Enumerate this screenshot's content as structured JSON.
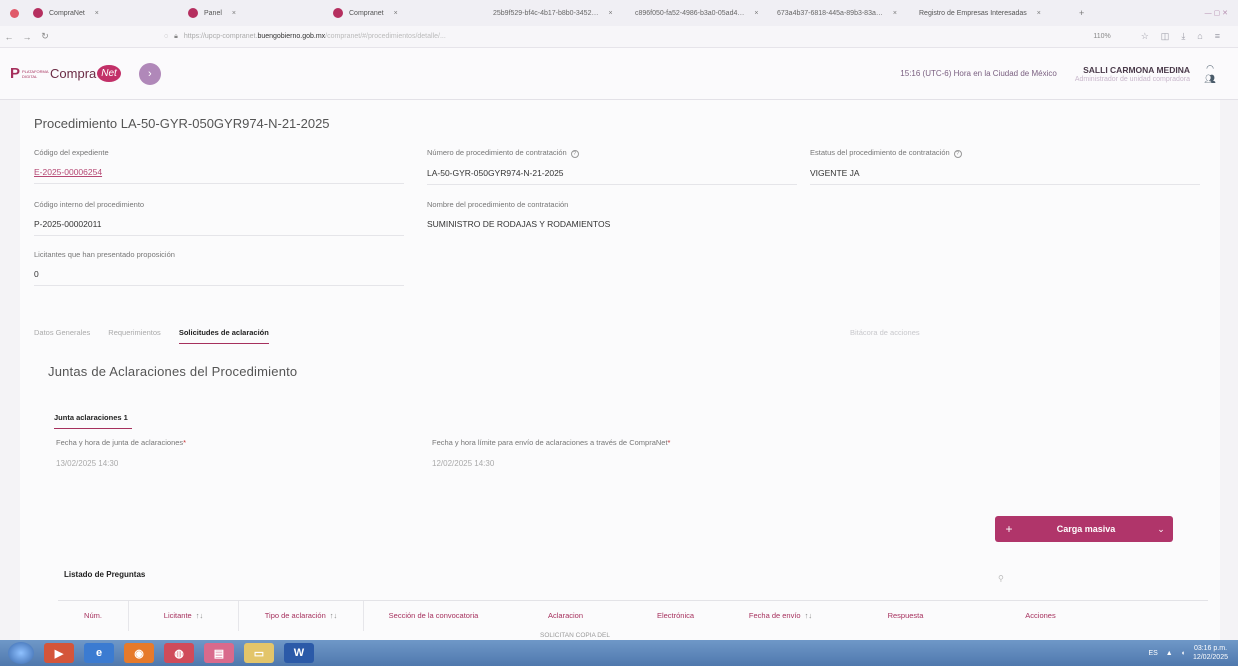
{
  "browser": {
    "tabs": [
      {
        "label": "CompraNet",
        "close": "×"
      },
      {
        "label": "Panel",
        "close": "×"
      },
      {
        "label": "Compranet",
        "close": "×"
      },
      {
        "label": "25b9f529-bf4c-4b17-b8b0-3452…",
        "close": "×"
      },
      {
        "label": "c896f050-fa52-4986-b3a0-05ad4…",
        "close": "×"
      },
      {
        "label": "673a4b37-6818-445a-89b3-83a…",
        "close": "×"
      },
      {
        "label": "Registro de Empresas Interesadas",
        "close": "×"
      }
    ],
    "new_tab": "+",
    "url_prefix": "https://upcp-compranet.",
    "url_host": "buengobierno.gob.mx",
    "url_suffix": "/compranet/#/procedimientos/detalle/...",
    "zoom": "110%"
  },
  "header": {
    "logo_prefix": "P",
    "logo_sub": "PLATAFORMA DIGITAL",
    "logo_main": "Compra",
    "logo_badge": "Net",
    "clock": "15:16 (UTC-6) Hora en la Ciudad de México",
    "user_name": "SALLI CARMONA MEDINA",
    "user_role": "Administrador de unidad compradora"
  },
  "procedure": {
    "title": "Procedimiento LA-50-GYR-050GYR974-N-21-2025",
    "codigo_expediente_label": "Código del expediente",
    "codigo_expediente": "E-2025-00006254",
    "numero_label": "Número de procedimiento de contratación",
    "numero": "LA-50-GYR-050GYR974-N-21-2025",
    "estatus_label": "Estatus del procedimiento de contratación",
    "estatus": "VIGENTE JA",
    "codigo_interno_label": "Código interno del procedimiento",
    "codigo_interno": "P-2025-00002011",
    "nombre_label": "Nombre del procedimiento de contratación",
    "nombre": "SUMINISTRO DE RODAJAS Y RODAMIENTOS",
    "licitantes_label": "Licitantes que han presentado proposición",
    "licitantes": "0"
  },
  "tabs": {
    "datos": "Datos Generales",
    "requerimientos": "Requerimientos",
    "solicitudes": "Solicitudes de aclaración",
    "bitacora": "Bitácora de acciones"
  },
  "juntas": {
    "title": "Juntas de Aclaraciones del Procedimiento",
    "tab": "Junta aclaraciones 1",
    "fecha_label": "Fecha y hora de junta de aclaraciones",
    "fecha": "13/02/2025 14:30",
    "limite_label": "Fecha y hora límite para envío de aclaraciones a través de CompraNet",
    "limite": "12/02/2025 14:30",
    "required": "*"
  },
  "carga": {
    "plus": "+",
    "label": "Carga masiva",
    "chevron": "⌄"
  },
  "list": {
    "title": "Listado de Preguntas",
    "columns": [
      "Núm.",
      "Licitante",
      "Tipo de aclaración",
      "Sección de la convocatoria",
      "Aclaracion",
      "Electrónica",
      "Fecha de envío",
      "Respuesta",
      "Acciones"
    ],
    "sort": "↑↓",
    "first_cell": "SOLICITAN COPIA DEL"
  },
  "taskbar": {
    "clock_time": "03:16 p.m.",
    "clock_date": "12/02/2025",
    "lang": "ES"
  }
}
